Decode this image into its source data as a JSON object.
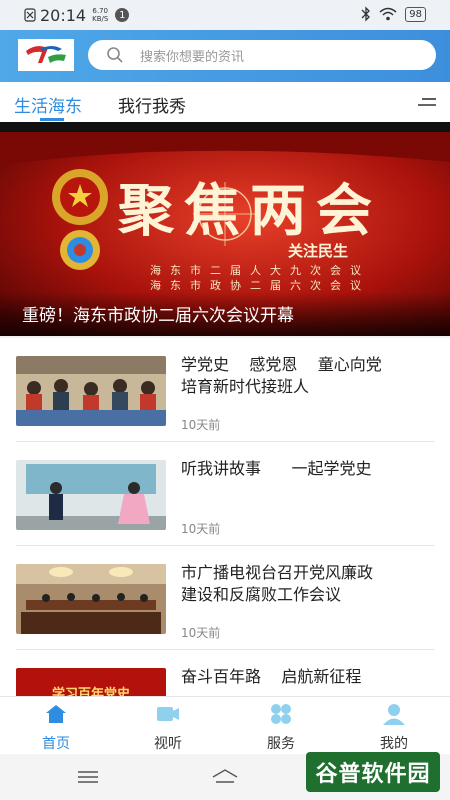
{
  "status_bar": {
    "time": "20:14",
    "net_speed_value": "6.70",
    "net_speed_unit": "KB/S",
    "notification_count": "1",
    "battery": "98"
  },
  "header": {
    "search_placeholder": "搜索你想要的资讯"
  },
  "tabs": [
    {
      "label": "生活海东",
      "active": true
    },
    {
      "label": "我行我秀",
      "active": false
    }
  ],
  "banner": {
    "caption": "重磅！海东市政协二届六次会议开幕",
    "headline": "聚焦两会",
    "subtitle_tag": "关注民生",
    "lines": [
      "海东市二届人大九次会议",
      "海东市政协二届六次会议"
    ]
  },
  "news": [
    {
      "title": "学党史    感党恩    童心向党\n培育新时代接班人",
      "time": "10天前",
      "thumb": "classroom"
    },
    {
      "title": "听我讲故事      一起学党史",
      "time": "10天前",
      "thumb": "stage"
    },
    {
      "title": "市广播电视台召开党风廉政\n建设和反腐败工作会议",
      "time": "10天前",
      "thumb": "meeting"
    },
    {
      "title": "奋斗百年路    启航新征程",
      "time": "",
      "thumb": "centenary",
      "thumb_text": "学习百年党史"
    }
  ],
  "bottom_nav": [
    {
      "label": "首页",
      "icon": "home-icon",
      "active": true
    },
    {
      "label": "视听",
      "icon": "video-icon",
      "active": false
    },
    {
      "label": "服务",
      "icon": "clover-icon",
      "active": false
    },
    {
      "label": "我的",
      "icon": "user-icon",
      "active": false
    }
  ],
  "watermark": "谷普软件园",
  "colors": {
    "accent": "#2e8de0",
    "header": "#4fa8e8",
    "banner_red": "#b3120c"
  }
}
